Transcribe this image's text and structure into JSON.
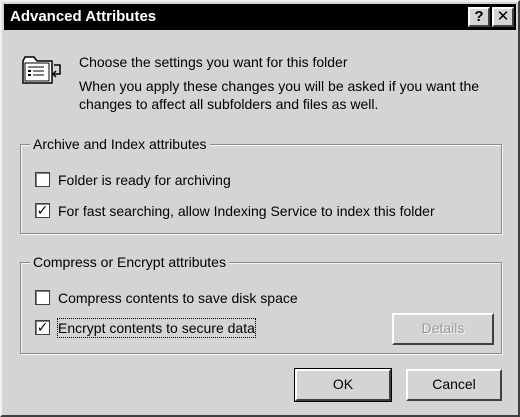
{
  "window": {
    "title": "Advanced Attributes",
    "help_glyph": "?",
    "close_glyph": "✕"
  },
  "header": {
    "icon": "folder-settings-icon",
    "line1": "Choose the settings you want for this folder",
    "line2": "When you apply these changes you will be asked if you want the",
    "line3": "changes to affect all subfolders and files as well."
  },
  "archive_group": {
    "title": "Archive and Index attributes",
    "options": [
      {
        "label": "Folder is ready for archiving",
        "checked": false,
        "check_glyph": ""
      },
      {
        "label": "For fast searching, allow Indexing Service to index this folder",
        "checked": true,
        "check_glyph": "✓"
      }
    ]
  },
  "compress_group": {
    "title": "Compress or Encrypt attributes",
    "options": [
      {
        "label": "Compress contents to save disk space",
        "checked": false,
        "check_glyph": ""
      },
      {
        "label": "Encrypt contents to secure data",
        "checked": true,
        "check_glyph": "✓"
      }
    ],
    "details_label": "Details",
    "details_enabled": false
  },
  "buttons": {
    "ok_label": "OK",
    "cancel_label": "Cancel"
  }
}
